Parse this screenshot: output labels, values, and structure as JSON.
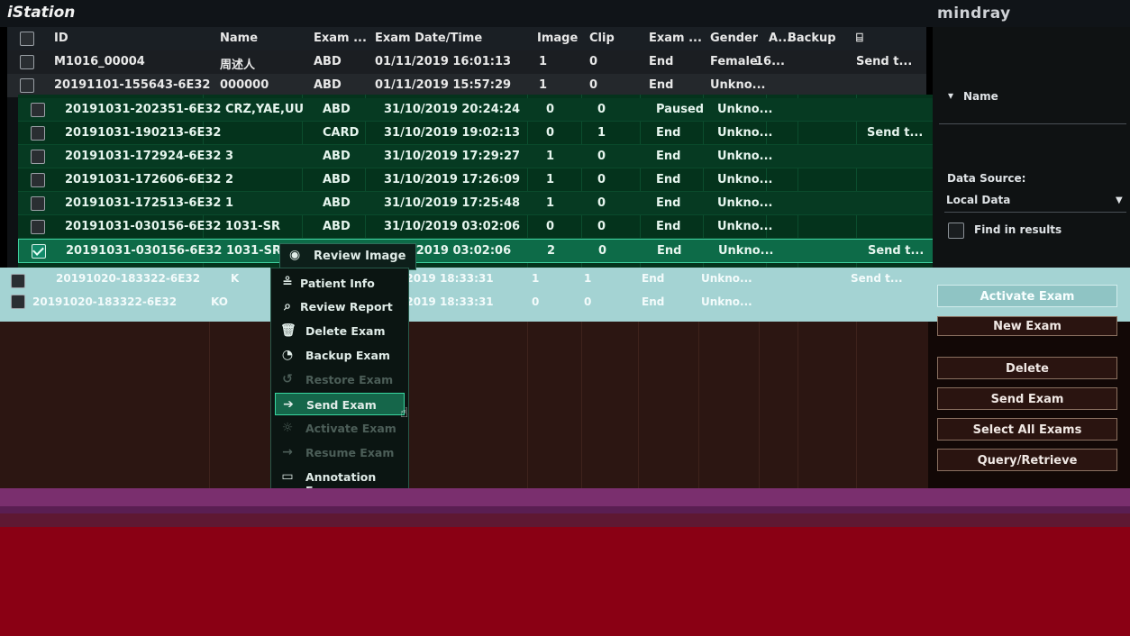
{
  "app": {
    "title": "iStation",
    "brand": "mindray"
  },
  "table": {
    "headers": [
      "ID",
      "Name",
      "Exam ...",
      "Exam Date/Time",
      "Image",
      "Clip",
      "Exam ...",
      "Gender",
      "A...",
      "Backup",
      "⌸"
    ],
    "top_rows": [
      {
        "id": "M1016_00004",
        "name": "周述人",
        "exam": "ABD",
        "datetime": "01/11/2019 16:01:13",
        "image": "1",
        "clip": "0",
        "status": "End",
        "gender": "Female",
        "age": "16...",
        "backup": "",
        "send": "Send t..."
      },
      {
        "id": "20191101-155643-6E32",
        "name": "000000",
        "exam": "ABD",
        "datetime": "01/11/2019 15:57:29",
        "image": "1",
        "clip": "0",
        "status": "End",
        "gender": "Unkno...",
        "age": "",
        "backup": "",
        "send": ""
      }
    ],
    "green_rows": [
      {
        "id": "20191031-202351-6E32",
        "name": "ČŘŽ,ÝÁÉ,ÚÛ",
        "exam": "ABD",
        "datetime": "31/10/2019 20:24:24",
        "image": "0",
        "clip": "0",
        "status": "Paused",
        "gender": "Unkno...",
        "send": ""
      },
      {
        "id": "20191031-190213-6E32",
        "name": "",
        "exam": "CARD",
        "datetime": "31/10/2019 19:02:13",
        "image": "0",
        "clip": "1",
        "status": "End",
        "gender": "Unkno...",
        "send": "Send t..."
      },
      {
        "id": "20191031-172924-6E32",
        "name": "3",
        "exam": "ABD",
        "datetime": "31/10/2019 17:29:27",
        "image": "1",
        "clip": "0",
        "status": "End",
        "gender": "Unkno...",
        "send": ""
      },
      {
        "id": "20191031-172606-6E32",
        "name": "2",
        "exam": "ABD",
        "datetime": "31/10/2019 17:26:09",
        "image": "1",
        "clip": "0",
        "status": "End",
        "gender": "Unkno...",
        "send": ""
      },
      {
        "id": "20191031-172513-6E32",
        "name": "1",
        "exam": "ABD",
        "datetime": "31/10/2019 17:25:48",
        "image": "1",
        "clip": "0",
        "status": "End",
        "gender": "Unkno...",
        "send": ""
      },
      {
        "id": "20191031-030156-6E32",
        "name": "1031-SR",
        "exam": "ABD",
        "datetime": "31/10/2019 03:02:06",
        "image": "0",
        "clip": "0",
        "status": "End",
        "gender": "Unkno...",
        "send": ""
      },
      {
        "id": "20191031-030156-6E32",
        "name": "1031-SR",
        "exam": "",
        "datetime": "/2019 03:02:06",
        "image": "2",
        "clip": "0",
        "status": "End",
        "gender": "Unkno...",
        "send": "Send t..."
      }
    ],
    "teal_rows": [
      {
        "id": "20191020-183322-6E32",
        "name": "K",
        "datetime": "/2019 18:33:31",
        "image": "1",
        "clip": "1",
        "status": "End",
        "gender": "Unkno...",
        "send": "Send t..."
      },
      {
        "id": "20191020-183322-6E32",
        "name": "KO",
        "datetime": "/2019 18:33:31",
        "image": "0",
        "clip": "0",
        "status": "End",
        "gender": "Unkno...",
        "send": ""
      }
    ]
  },
  "context_menu": {
    "review_image": "Review Image",
    "items": [
      {
        "label": "Patient Info",
        "icon": "patient-icon"
      },
      {
        "label": "Review Report",
        "icon": "search-icon"
      },
      {
        "label": "Delete Exam",
        "icon": "trash-icon"
      },
      {
        "label": "Backup Exam",
        "icon": "backup-icon"
      },
      {
        "label": "Restore Exam",
        "icon": "restore-icon"
      },
      {
        "label": "Send Exam",
        "icon": "send-icon"
      },
      {
        "label": "Activate Exam",
        "icon": "activate-icon"
      },
      {
        "label": "Resume Exam",
        "icon": "resume-icon"
      },
      {
        "label": "Annotation Exam",
        "icon": "annotation-icon"
      }
    ]
  },
  "right_panel": {
    "name_label": "Name",
    "data_source_label": "Data Source:",
    "data_source_value": "Local Data",
    "find_in_results": "Find in results",
    "buttons": {
      "activate": "Activate Exam",
      "new": "New Exam",
      "delete": "Delete",
      "send": "Send Exam",
      "select_all": "Select All Exams",
      "query": "Query/Retrieve"
    }
  }
}
